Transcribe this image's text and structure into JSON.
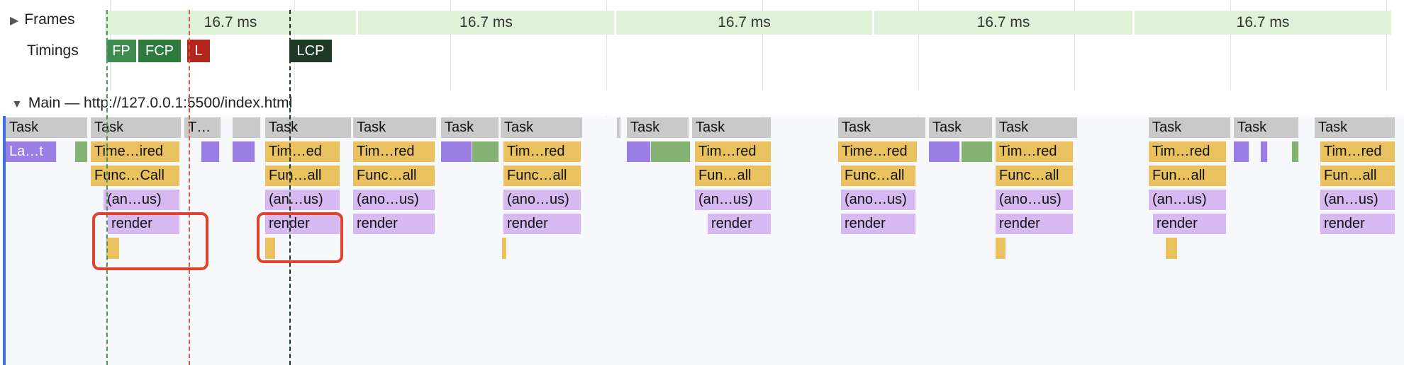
{
  "frames_label": "Frames",
  "frame_durations": [
    "16.7 ms",
    "16.7 ms",
    "16.7 ms",
    "16.7 ms",
    "16.7 ms"
  ],
  "timings_label": "Timings",
  "markers": [
    "FP",
    "FCP",
    "L",
    "LCP"
  ],
  "marker_colors": {
    "FP": "#3f8a4e",
    "FCP": "#2f7a3f",
    "L": "#b3261e",
    "LCP": "#1e3a27"
  },
  "main_label": "Main — http://127.0.0.1:5500/index.html",
  "task_label": "Task",
  "tasks_row": [
    "Task",
    "Task",
    "T…",
    "Task",
    "Task",
    "Task",
    "Task",
    "Task",
    "Task",
    "Task",
    "Task",
    "Task",
    "Task",
    "Task",
    "Task",
    "Task"
  ],
  "row2": [
    "La…t",
    "Time…ired",
    "Tim…ed",
    "Tim…red",
    "Tim…red",
    "Tim…red",
    "Time…red",
    "Tim…red",
    "Tim…red",
    "Tim…red"
  ],
  "row3": [
    "Func…Call",
    "Fun…all",
    "Func…all",
    "Func…all",
    "Fun…all",
    "Func…all",
    "Func…all",
    "Fun…all",
    "Fun…all"
  ],
  "row4": [
    "(an…us)",
    "(an…us)",
    "(ano…us)",
    "(ano…us)",
    "(an…us)",
    "(ano…us)",
    "(ano…us)",
    "(an…us)",
    "(an…us)"
  ],
  "row5": [
    "render",
    "render",
    "render",
    "render",
    "render",
    "render",
    "render",
    "render",
    "render"
  ]
}
